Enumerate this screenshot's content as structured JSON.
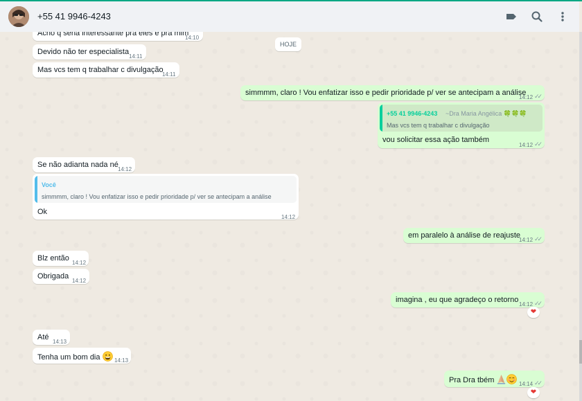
{
  "header": {
    "title": "+55 41 9946-4243"
  },
  "date_divider": "HOJE",
  "messages": [
    {
      "text": "Acho q seria interessante pra eles e pra mim",
      "time": "14:10"
    },
    {
      "text": "Devido não ter especialista",
      "time": "14:11"
    },
    {
      "text": "Mas vcs tem q trabalhar c divulgação",
      "time": "14:11"
    },
    {
      "text": "simmmm, claro ! Vou enfatizar isso e pedir prioridade p/ ver se antecipam a análise",
      "time": "14:12"
    },
    {
      "quote_name": "+55 41 9946-4243",
      "quote_sub": "~Dra Maria Angélica 🍀🍀🍀",
      "quote_text": "Mas vcs tem q trabalhar c divulgação",
      "text": "vou solicitar essa ação também",
      "time": "14:12"
    },
    {
      "text": "Se não adianta nada né",
      "time": "14:12"
    },
    {
      "quote_name": "Você",
      "quote_text": "simmmm, claro ! Vou enfatizar isso e pedir prioridade p/ ver se antecipam a análise",
      "text": "Ok",
      "time": "14:12"
    },
    {
      "text": "em paralelo à análise de reajuste",
      "time": "14:12"
    },
    {
      "text": "Blz então",
      "time": "14:12"
    },
    {
      "text": "Obrigada",
      "time": "14:12"
    },
    {
      "text": "imagina , eu que agradeço o retorno",
      "time": "14:12",
      "reaction": "❤"
    },
    {
      "text": "Até",
      "time": "14:13"
    },
    {
      "text": "Tenha um bom dia",
      "time": "14:13"
    },
    {
      "text": "Pra Dra tbém",
      "time": "14:14",
      "reaction": "❤"
    }
  ],
  "icons": [
    "avatar",
    "label-icon",
    "search-icon",
    "menu-icon",
    "read-ticks-icon",
    "clover-icon",
    "grinning-face-icon",
    "folded-hands-icon",
    "smiling-face-icon",
    "heart-icon"
  ],
  "colors": {
    "incoming": "#ffffff",
    "outgoing": "#d9fdd3",
    "accent": "#00a884",
    "quote_you": "#53bdeb",
    "reaction": "#e53935"
  }
}
